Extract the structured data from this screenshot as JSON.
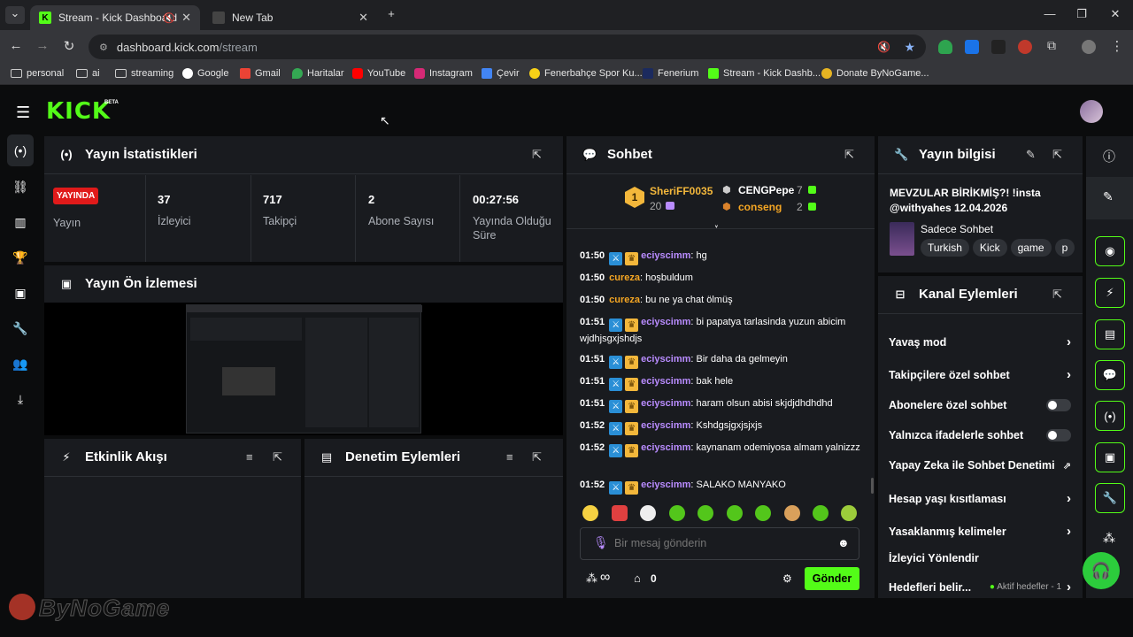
{
  "browser": {
    "tabs": [
      {
        "title": "Stream - Kick Dashboard",
        "active": true
      },
      {
        "title": "New Tab",
        "active": false
      }
    ],
    "url": {
      "host": "dashboard.kick.com",
      "path": "/stream"
    },
    "bookmarks": [
      "personal",
      "ai",
      "streaming",
      "Google",
      "Gmail",
      "Haritalar",
      "YouTube",
      "Instagram",
      "Çevir",
      "Fenerbahçe Spor Ku...",
      "Fenerium",
      "Stream - Kick Dashb...",
      "Donate ByNoGame..."
    ]
  },
  "header": {
    "logo": "KICK",
    "beta": "BETA"
  },
  "stats": {
    "title": "Yayın İstatistikleri",
    "live_badge": "YAYINDA",
    "items": [
      {
        "value": "",
        "label": "Yayın"
      },
      {
        "value": "37",
        "label": "İzleyici"
      },
      {
        "value": "717",
        "label": "Takipçi"
      },
      {
        "value": "2",
        "label": "Abone Sayısı"
      },
      {
        "value": "00:27:56",
        "label": "Yayında Olduğu Süre"
      }
    ]
  },
  "preview": {
    "title": "Yayın Ön İzlemesi"
  },
  "activity": {
    "title": "Etkinlik Akışı"
  },
  "moderation": {
    "title": "Denetim Eylemleri"
  },
  "chat": {
    "title": "Sohbet",
    "top": [
      {
        "rank": "1",
        "name": "SheriFF0035",
        "count": "20"
      },
      {
        "name": "CENGPepe",
        "count": "7"
      },
      {
        "name": "conseng",
        "count": "2"
      }
    ],
    "messages": [
      {
        "time": "01:50",
        "user": "eciyscimm",
        "text": "hg",
        "badges": true
      },
      {
        "time": "01:50",
        "user": "cureza",
        "text": "hoşbuldum",
        "badges": false
      },
      {
        "time": "01:50",
        "user": "cureza",
        "text": "bu ne ya chat ölmüş",
        "badges": false
      },
      {
        "time": "01:51",
        "user": "eciyscimm",
        "text": "bi papatya tarlasinda yuzun abicim wjdhjsgxjshdjs",
        "badges": true
      },
      {
        "time": "01:51",
        "user": "eciyscimm",
        "text": "Bir daha da gelmeyin",
        "badges": true
      },
      {
        "time": "01:51",
        "user": "eciyscimm",
        "text": "bak hele",
        "badges": true
      },
      {
        "time": "01:51",
        "user": "eciyscimm",
        "text": "haram olsun abisi skjdjdhdhdhd",
        "badges": true
      },
      {
        "time": "01:52",
        "user": "eciyscimm",
        "text": "Kshdgsjgxjsjxjs",
        "badges": true
      },
      {
        "time": "01:52",
        "user": "eciyscimm",
        "text": "kaynanam odemiyosa almam yalnizzz",
        "badges": true
      },
      {
        "time": "01:52",
        "user": "eciyscimm",
        "text": "SALAKO MANYAKO",
        "badges": true
      }
    ],
    "input_placeholder": "Bir mesaj gönderin",
    "viewers": "∞",
    "points": "0",
    "send_label": "Gönder"
  },
  "stream_info": {
    "title": "Yayın bilgisi",
    "stream_title": "MEVZULAR BİRİKMİŞ?! !insta @withyahes 12.04.2026",
    "category": "Sadece Sohbet",
    "tags": [
      "Turkish",
      "Kick",
      "game",
      "p"
    ]
  },
  "channel_actions": {
    "title": "Kanal Eylemleri",
    "rows": [
      {
        "label": "Yavaş mod",
        "control": "chevron"
      },
      {
        "label": "Takipçilere özel sohbet",
        "control": "chevron"
      },
      {
        "label": "Abonelere özel sohbet",
        "control": "toggle"
      },
      {
        "label": "Yalnızca ifadelerle sohbet",
        "control": "toggle"
      },
      {
        "label": "Yapay Zeka ile Sohbet Denetimi",
        "control": "external"
      },
      {
        "label": "Hesap yaşı kısıtlaması",
        "control": "chevron"
      },
      {
        "label": "Yasaklanmış kelimeler",
        "control": "chevron"
      },
      {
        "label": "İzleyici Yönlendir",
        "control": "none"
      },
      {
        "label": "Hedefleri belir...",
        "control": "chevron"
      }
    ],
    "goals_status": "Aktif hedefler - 1"
  },
  "watermark": "ByNoGame",
  "colors": {
    "accent": "#53fc18",
    "live": "#e01a1a",
    "panel": "#191b1f",
    "chat_user": "#b98cff",
    "chat_user2": "#f5a623"
  }
}
